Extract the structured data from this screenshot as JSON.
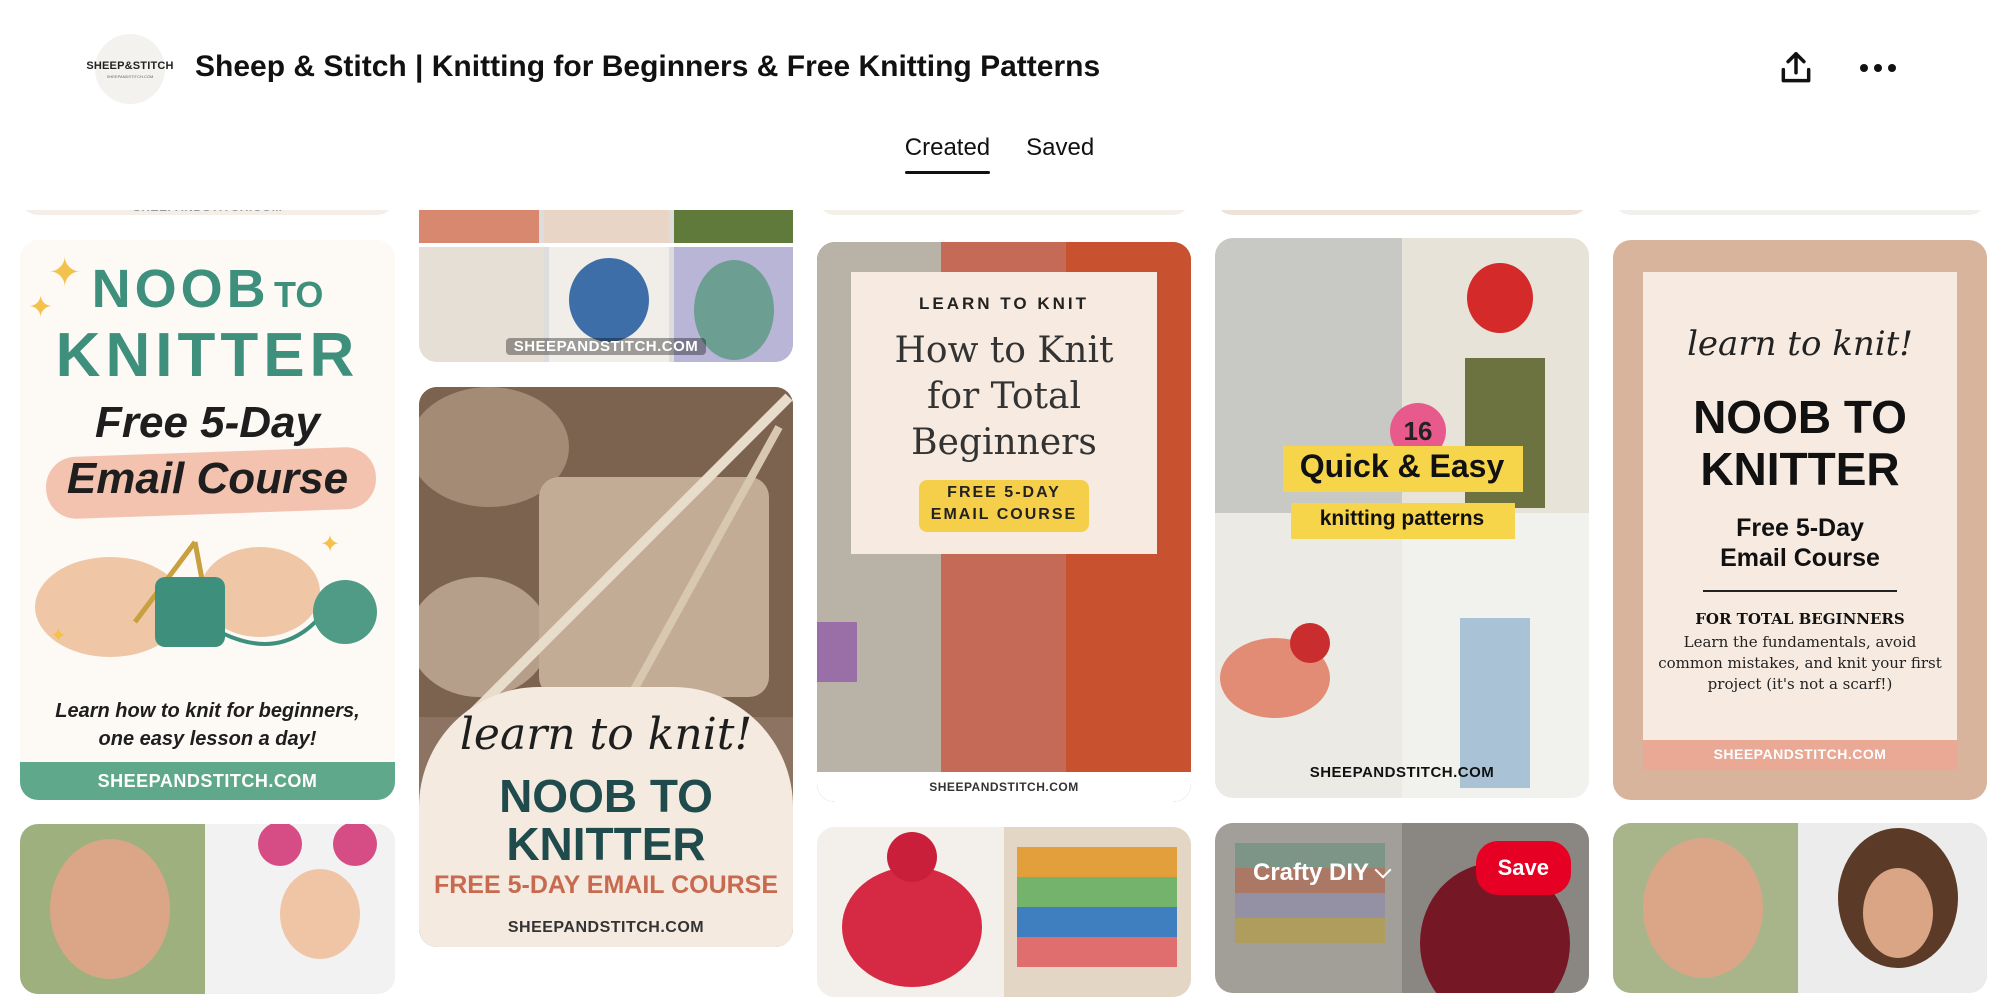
{
  "profile": {
    "avatar_brand": "SHEEP&STITCH",
    "avatar_site": "SHEEPANDSTITCH.COM",
    "title": "Sheep & Stitch | Knitting for Beginners & Free Knitting Patterns"
  },
  "header_icons": {
    "share": "share-icon",
    "more": "more-icon"
  },
  "tabs": [
    {
      "label": "Created",
      "active": true
    },
    {
      "label": "Saved",
      "active": false
    }
  ],
  "pins": {
    "noob_course": {
      "line1": "NOOB",
      "line1b": "TO",
      "line2": "KNITTER",
      "line3": "Free 5-Day",
      "line4": "Email Course",
      "caption1": "Learn how to knit for beginners,",
      "caption2": "one easy lesson a day!",
      "site": "SHEEPANDSTITCH.COM"
    },
    "collage_site": "SHEEPANDSTITCH.COM",
    "learn_swatch": {
      "script": "learn to knit!",
      "line1": "NOOB TO",
      "line2": "KNITTER",
      "line3": "FREE 5-DAY EMAIL COURSE",
      "site": "SHEEPANDSTITCH.COM"
    },
    "total_beginners": {
      "kicker": "LEARN TO KNIT",
      "line1": "How to Knit",
      "line2": "for Total",
      "line3": "Beginners",
      "badge1": "FREE 5-DAY",
      "badge2": "EMAIL COURSE",
      "site": "SHEEPANDSTITCH.COM"
    },
    "quick_easy": {
      "number": "16",
      "line1": "Quick & Easy",
      "line2": "knitting patterns",
      "site": "SHEEPANDSTITCH.COM"
    },
    "right_course": {
      "script": "learn to knit!",
      "line1": "NOOB TO",
      "line2": "KNITTER",
      "line3": "Free 5-Day",
      "line4": "Email Course",
      "sub_heading": "FOR TOTAL BEGINNERS",
      "sub_text": "Learn the fundamentals, avoid common mistakes, and knit your first project (it's not a scarf!)",
      "site": "SHEEPANDSTITCH.COM"
    },
    "top_partial_site": "SHEEPANDSTITCH.COM"
  },
  "hover_pin": {
    "board": "Crafty DIY",
    "save_label": "Save"
  },
  "colors": {
    "brand_red": "#e60023",
    "teal": "#3f8f7d",
    "peach": "#f3c3b0",
    "cream": "#f7ebe1",
    "dark_teal": "#1f4b4d"
  }
}
